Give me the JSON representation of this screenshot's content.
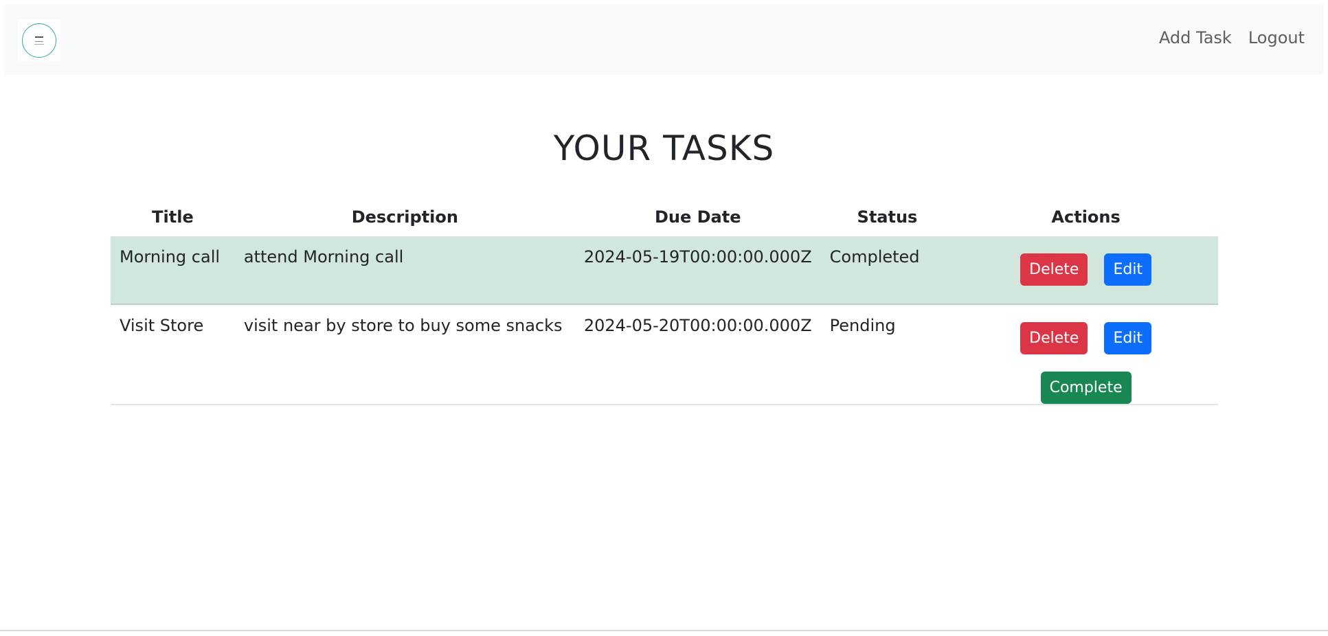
{
  "navbar": {
    "logo_icon": "logo-badge",
    "links": {
      "add_task": "Add Task",
      "logout": "Logout"
    }
  },
  "page": {
    "title": "YOUR TASKS"
  },
  "table": {
    "headers": {
      "title": "Title",
      "description": "Description",
      "due_date": "Due Date",
      "status": "Status",
      "actions": "Actions"
    },
    "rows": [
      {
        "title": "Morning call",
        "description": "attend Morning call",
        "due_date": "2024-05-19T00:00:00.000Z",
        "status": "Completed",
        "delete_label": "Delete",
        "edit_label": "Edit"
      },
      {
        "title": "Visit Store",
        "description": "visit near by store to buy some snacks",
        "due_date": "2024-05-20T00:00:00.000Z",
        "status": "Pending",
        "delete_label": "Delete",
        "edit_label": "Edit",
        "complete_label": "Complete"
      }
    ]
  },
  "colors": {
    "completed_row": "#d1e7dd",
    "delete": "#dc3545",
    "edit": "#0d6efd",
    "complete": "#198754",
    "navbar_bg": "#f8f9fa"
  }
}
